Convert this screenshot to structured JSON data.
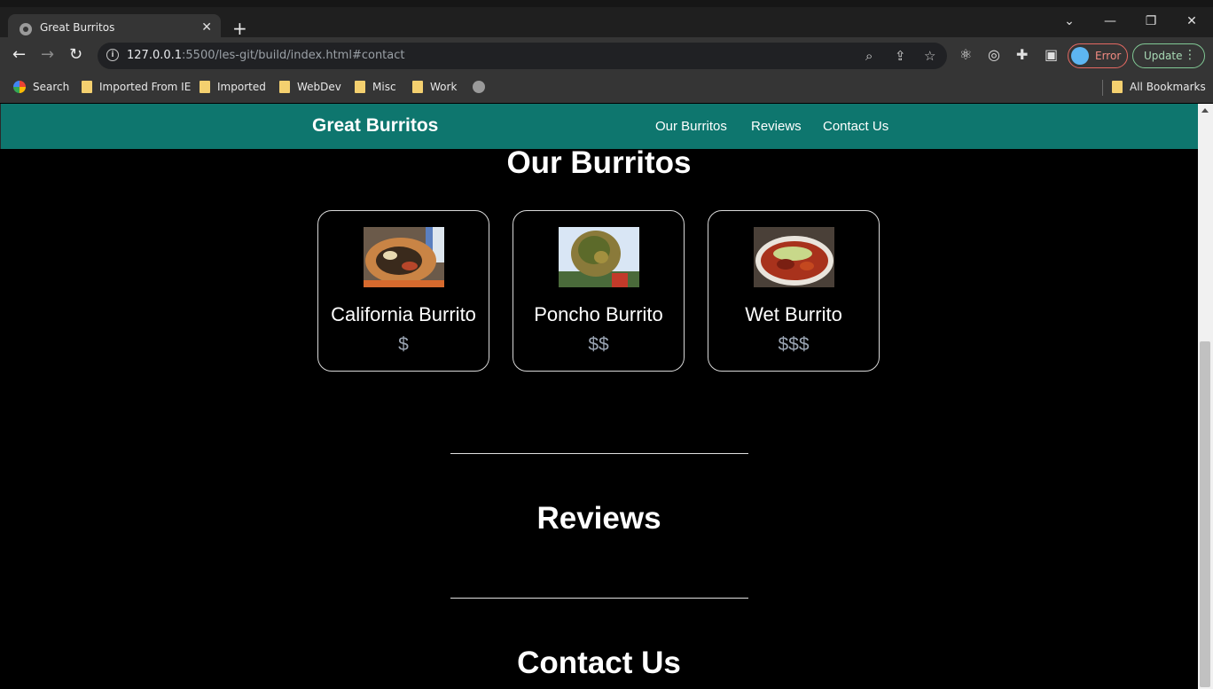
{
  "browser": {
    "tab_title": "Great Burritos",
    "tab_close": "✕",
    "new_tab": "+",
    "url_host": "127.0.0.1",
    "url_rest": ":5500/les-git/build/index.html#contact",
    "profile_status": "Error",
    "update_label": "Update",
    "window_controls": {
      "tabsearch": "⌄",
      "minimize": "—",
      "restore": "❐",
      "close": "✕"
    }
  },
  "bookmarks": {
    "items": [
      {
        "label": "Search",
        "icon": "google-icon"
      },
      {
        "label": "Imported From IE",
        "icon": "folder-icon"
      },
      {
        "label": "Imported",
        "icon": "folder-icon"
      },
      {
        "label": "WebDev",
        "icon": "folder-icon"
      },
      {
        "label": "Misc",
        "icon": "folder-icon"
      },
      {
        "label": "Work",
        "icon": "folder-icon"
      }
    ],
    "all_bookmarks": "All Bookmarks"
  },
  "site": {
    "brand": "Great Burritos",
    "nav": [
      "Our Burritos",
      "Reviews",
      "Contact Us"
    ],
    "sections": {
      "burritos_title": "Our Burritos",
      "reviews_title": "Reviews",
      "contact_title": "Contact Us"
    },
    "burritos": [
      {
        "name": "California Burrito",
        "price": "$"
      },
      {
        "name": "Poncho Burrito",
        "price": "$$"
      },
      {
        "name": "Wet Burrito",
        "price": "$$$"
      }
    ]
  },
  "colors": {
    "navbar": "#0e766e",
    "background": "#000000",
    "price": "#9aa4b2"
  }
}
